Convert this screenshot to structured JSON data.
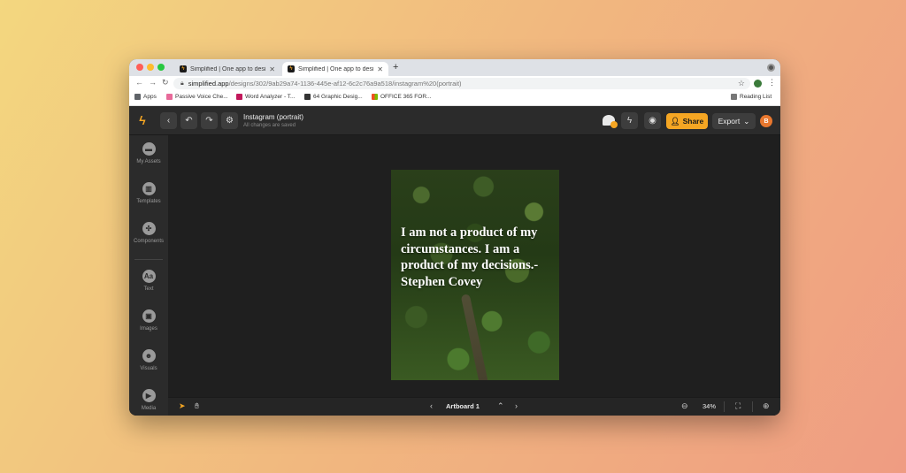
{
  "browser": {
    "tabs": [
      {
        "title": "Simplified | One app to design",
        "close": "✕"
      },
      {
        "title": "Simplified | One app to design",
        "close": "✕"
      }
    ],
    "new_tab": "+",
    "url_domain": "simplified.app",
    "url_path": "/designs/302/9ab29a74-1136-445e-af12-6c2c76a9a518/instagram%20(portrait)",
    "bookmarks": [
      {
        "label": "Apps",
        "color": "#5f6368"
      },
      {
        "label": "Passive Voice Che...",
        "color": "#e86a9a"
      },
      {
        "label": "Word Analyzer - T...",
        "color": "#c2185b"
      },
      {
        "label": "64 Graphic Desig...",
        "color": "#333333"
      },
      {
        "label": "OFFICE 365 FOR...",
        "color": "#f25022"
      }
    ],
    "reading_list": "Reading List"
  },
  "app": {
    "doc_title": "Instagram (portrait)",
    "doc_status": "All changes are saved",
    "share_label": "Share",
    "export_label": "Export",
    "avatar_initial": "B",
    "accent_color": "#f5a623"
  },
  "sidebar": {
    "items": [
      {
        "label": "My Assets",
        "icon": "folder-icon"
      },
      {
        "label": "Templates",
        "icon": "templates-icon"
      },
      {
        "label": "Components",
        "icon": "components-icon"
      },
      {
        "label": "Text",
        "icon": "text-icon",
        "glyph": "Aa"
      },
      {
        "label": "Images",
        "icon": "image-icon"
      },
      {
        "label": "Visuals",
        "icon": "visuals-icon"
      },
      {
        "label": "Media",
        "icon": "play-icon",
        "glyph": "▶"
      }
    ]
  },
  "canvas": {
    "quote": "I am not a product of my circumstances. I am a product of my decisions.-Stephen Covey"
  },
  "bottombar": {
    "artboard_label": "Artboard 1",
    "zoom": "34%"
  }
}
